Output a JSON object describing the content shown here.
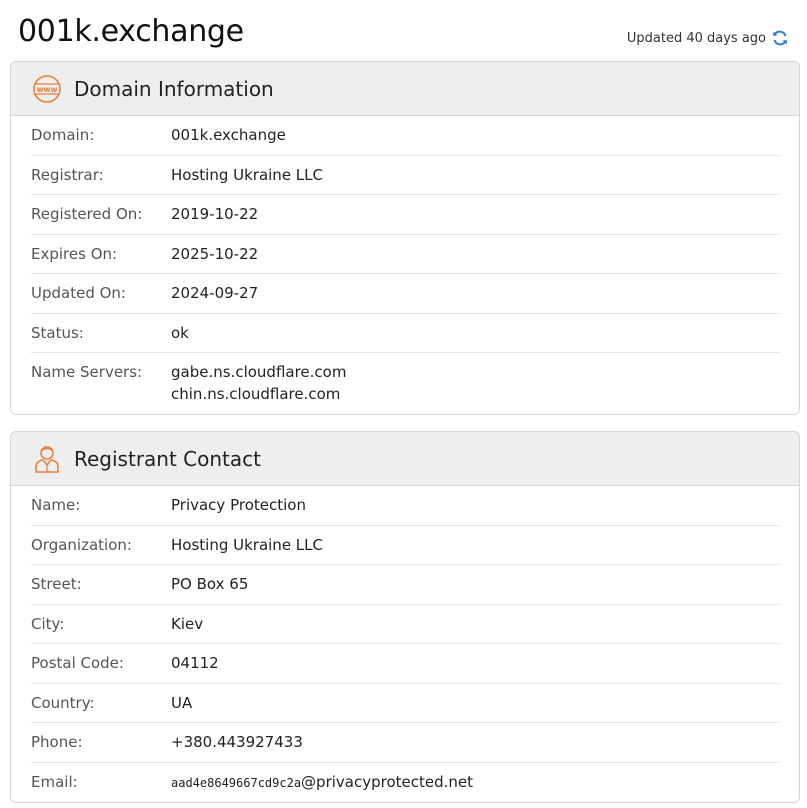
{
  "header": {
    "title": "001k.exchange",
    "updated_text": "Updated 40 days ago",
    "refresh_icon": "refresh-icon",
    "accent_color": "#2f7fd8"
  },
  "domain_info": {
    "title": "Domain Information",
    "icon": "www-icon",
    "icon_color": "#e8813a",
    "rows": [
      {
        "label": "Domain:",
        "value": "001k.exchange"
      },
      {
        "label": "Registrar:",
        "value": "Hosting Ukraine LLC"
      },
      {
        "label": "Registered On:",
        "value": "2019-10-22"
      },
      {
        "label": "Expires On:",
        "value": "2025-10-22"
      },
      {
        "label": "Updated On:",
        "value": "2024-09-27"
      },
      {
        "label": "Status:",
        "value": "ok"
      }
    ],
    "name_servers": {
      "label": "Name Servers:",
      "values": [
        "gabe.ns.cloudflare.com",
        "chin.ns.cloudflare.com"
      ]
    }
  },
  "registrant": {
    "title": "Registrant Contact",
    "icon": "person-icon",
    "rows": [
      {
        "label": "Name:",
        "value": "Privacy Protection"
      },
      {
        "label": "Organization:",
        "value": "Hosting Ukraine LLC"
      },
      {
        "label": "Street:",
        "value": "PO Box 65"
      },
      {
        "label": "City:",
        "value": "Kiev"
      },
      {
        "label": "Postal Code:",
        "value": "04112"
      },
      {
        "label": "Country:",
        "value": "UA"
      },
      {
        "label": "Phone:",
        "value": "+380.443927433"
      }
    ],
    "email": {
      "label": "Email:",
      "user": "aad4e8649667cd9c2a",
      "domain": "@privacyprotected.net"
    }
  }
}
